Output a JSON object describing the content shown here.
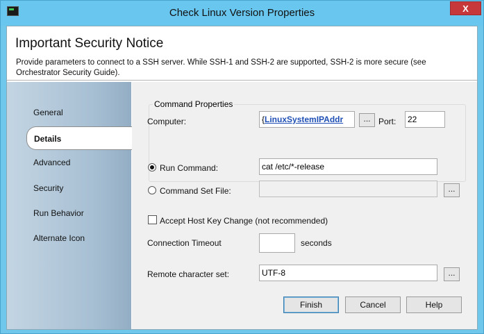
{
  "window": {
    "title": "Check Linux Version Properties",
    "close_label": "X"
  },
  "header": {
    "title": "Important Security Notice",
    "description": "Provide parameters to connect to a SSH server. While SSH-1 and SSH-2 are supported, SSH-2 is more secure (see Orchestrator Security Guide)."
  },
  "sidebar": {
    "items": [
      {
        "label": "General"
      },
      {
        "label": "Details"
      },
      {
        "label": "Advanced"
      },
      {
        "label": "Security"
      },
      {
        "label": "Run Behavior"
      },
      {
        "label": "Alternate Icon"
      }
    ],
    "active": "Details"
  },
  "command_properties": {
    "group_label": "Command Properties",
    "computer_label": "Computer:",
    "computer_prefix": "{",
    "computer_value": "LinuxSystemIPAddr",
    "browse_label": "...",
    "port_label": "Port:",
    "port_value": "22",
    "run_command_label": "Run Command:",
    "run_command_value": "cat /etc/*-release",
    "command_set_file_label": "Command Set File:",
    "command_set_file_value": ""
  },
  "options": {
    "accept_host_key_label": "Accept Host Key Change (not recommended)",
    "connection_timeout_label": "Connection Timeout",
    "connection_timeout_value": "",
    "seconds_label": "seconds",
    "remote_charset_label": "Remote character set:",
    "remote_charset_value": "UTF-8"
  },
  "footer": {
    "finish_label": "Finish",
    "cancel_label": "Cancel",
    "help_label": "Help"
  }
}
